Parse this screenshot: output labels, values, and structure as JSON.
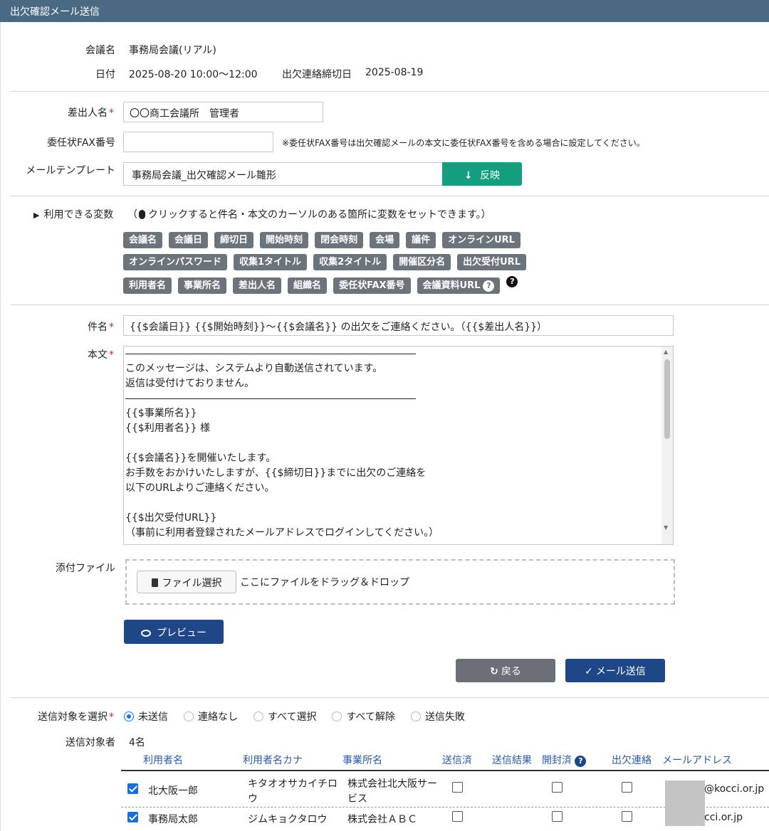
{
  "title": "出欠確認メール送信",
  "meeting": {
    "name_label": "会議名",
    "name_value": "事務局会議(リアル)",
    "date_label": "日付",
    "date_value": "2025-08-20 10:00～12:00",
    "deadline_label": "出欠連絡締切日",
    "deadline_value": "2025-08-19"
  },
  "form": {
    "sender_label": "差出人名",
    "sender_value": "〇〇商工会議所　管理者",
    "fax_label": "委任状FAX番号",
    "fax_value": "",
    "fax_note": "※委任状FAX番号は出欠確認メールの本文に委任状FAX番号を含める場合に設定してください。",
    "template_label": "メールテンプレート",
    "template_value": "事務局会議_出欠確認メール雛形",
    "apply_button": "反映",
    "required_mark": "*"
  },
  "variables": {
    "toggle_label": "利用できる変数",
    "hint": "クリックすると件名・本文のカーソルのある箇所に変数をセットできます。）",
    "hint_open": "（",
    "row1": [
      "会議名",
      "会議日",
      "締切日",
      "開始時刻",
      "閉会時刻",
      "会場",
      "議件",
      "オンラインURL"
    ],
    "row2": [
      "オンラインパスワード",
      "収集1タイトル",
      "収集2タイトル",
      "開催区分名",
      "出欠受付URL"
    ],
    "row3": [
      "利用者名",
      "事業所名",
      "差出人名",
      "組織名",
      "委任状FAX番号",
      "会議資料URL"
    ]
  },
  "mail": {
    "subject_label": "件名",
    "subject_value": "{{$会議日}} {{$開始時刻}}～{{$会議名}} の出欠をご連絡ください。（{{$差出人名}}）",
    "body_label": "本文",
    "body_lines": [
      "————————————————————————————————————————",
      " このメッセージは、システムより自動送信されています。",
      " 返信は受付けておりません。",
      "————————————————————————————————————————",
      "{{$事業所名}}",
      "{{$利用者名}} 様",
      "",
      "{{$会議名}}を開催いたします。",
      "お手数をおかけいたしますが、{{$締切日}}までに出欠のご連絡を",
      "以下のURLよりご連絡ください。",
      "",
      "{{$出欠受付URL}}",
      "（事前に利用者登録されたメールアドレスでログインしてください。）"
    ]
  },
  "attachment": {
    "label": "添付ファイル",
    "button": "ファイル選択",
    "drop_hint": "ここにファイルをドラッグ＆ドロップ"
  },
  "actions": {
    "preview": "プレビュー",
    "back": "戻る",
    "send": "メール送信"
  },
  "targets": {
    "select_label": "送信対象を選択",
    "options": [
      "未送信",
      "連絡なし",
      "すべて選択",
      "すべて解除",
      "送信失敗"
    ],
    "selected": "未送信",
    "count_label": "送信対象者",
    "count_value": "4名",
    "columns": [
      "利用者名",
      "利用者名カナ",
      "事業所名",
      "送信済",
      "送信結果",
      "開封済",
      "出欠連絡",
      "メールアドレス"
    ],
    "rows": [
      {
        "checked": true,
        "name": "北大阪一郎",
        "kana_1": "キタオオサカイチロ",
        "kana_2": "ウ",
        "office_1": "株式会社北大阪サー",
        "office_2": "ビス",
        "email": "@kocci.or.jp"
      },
      {
        "checked": true,
        "name": "事務局太郎",
        "kana_1": "ジムキョクタロウ",
        "kana_2": "",
        "office_1": "株式会社ＡＢＣ",
        "office_2": "",
        "email": "cci.or.jp"
      }
    ]
  },
  "colors": {
    "titlebar": "#4a6a84",
    "accent_green": "#129f7e",
    "navy": "#1f4788",
    "chip": "#6b737b",
    "required": "#dd2222",
    "link_header": "#2a5aa8"
  }
}
